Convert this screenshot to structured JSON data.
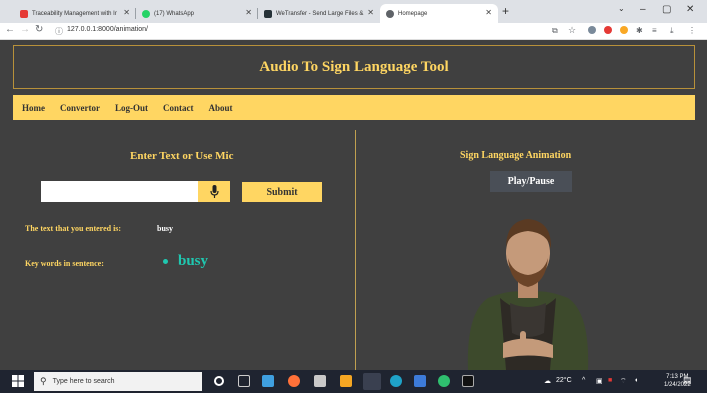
{
  "browser": {
    "tabs": [
      {
        "label": "Traceability Management with Ir",
        "fav": "#e53935"
      },
      {
        "label": "(17) WhatsApp",
        "fav": "#25d366"
      },
      {
        "label": "WeTransfer - Send Large Files & ",
        "fav": "#263238"
      },
      {
        "label": "Homepage",
        "fav": "#5f6368"
      }
    ],
    "url": "127.0.0.1:8000/animation/",
    "new_tab": "+",
    "win_minimize": "–",
    "win_restore": "▢",
    "win_close": "✕"
  },
  "site": {
    "title": "Audio To Sign Language Tool",
    "menu": [
      "Home",
      "Convertor",
      "Log-Out",
      "Contact",
      "About"
    ],
    "left": {
      "heading": "Enter Text or Use Mic",
      "input_value": "",
      "submit": "Submit",
      "entered_label": "The text that you entered is:",
      "entered_value": "busy",
      "keywords_label": "Key words in sentence:",
      "keywords": [
        "busy"
      ]
    },
    "right": {
      "heading": "Sign Language Animation",
      "play_button": "Play/Pause"
    }
  },
  "taskbar": {
    "search_placeholder": "Type here to search",
    "weather": "22°C",
    "time": "7:13 PM",
    "date": "1/24/2022"
  },
  "colors": {
    "accent": "#ffd662",
    "background": "#404040",
    "keyword": "#1fc8b0"
  }
}
